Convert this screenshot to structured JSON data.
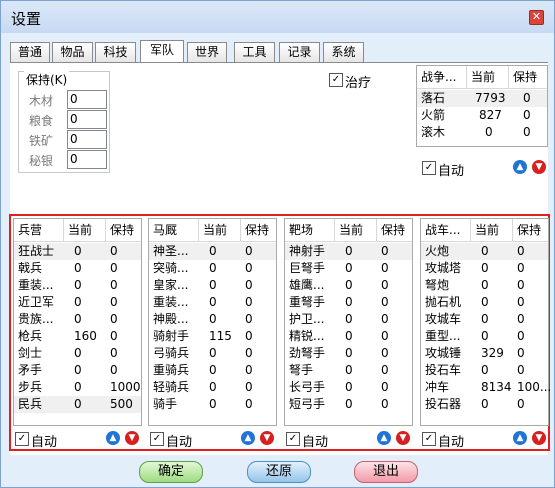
{
  "window": {
    "title": "设置",
    "close_glyph": "✕"
  },
  "tabs": [
    "普通",
    "物品",
    "科技",
    "军队",
    "世界",
    "工具",
    "记录",
    "系统"
  ],
  "active_tab": "军队",
  "keep_group": {
    "label": "保持(K)",
    "items": [
      {
        "label": "木材",
        "value": "0"
      },
      {
        "label": "粮食",
        "value": "0"
      },
      {
        "label": "铁矿",
        "value": "0"
      },
      {
        "label": "秘银",
        "value": "0"
      }
    ]
  },
  "heal": {
    "label": "治疗",
    "checked": true
  },
  "war_table": {
    "headers": [
      "战争...",
      "当前",
      "保持"
    ],
    "rows": [
      [
        "落石",
        "7793",
        "0"
      ],
      [
        "火箭",
        "827",
        "0"
      ],
      [
        "滚木",
        "0",
        "0"
      ]
    ],
    "auto_label": "自动"
  },
  "panels": [
    {
      "headers": [
        "兵营",
        "当前",
        "保持"
      ],
      "rows": [
        [
          "狂战士",
          "0",
          "0"
        ],
        [
          "戟兵",
          "0",
          "0"
        ],
        [
          "重装...",
          "0",
          "0"
        ],
        [
          "近卫军",
          "0",
          "0"
        ],
        [
          "贵族...",
          "0",
          "0"
        ],
        [
          "枪兵",
          "160",
          "0"
        ],
        [
          "剑士",
          "0",
          "0"
        ],
        [
          "矛手",
          "0",
          "0"
        ],
        [
          "步兵",
          "0",
          "1000"
        ],
        [
          "民兵",
          "0",
          "500"
        ]
      ],
      "auto_label": "自动"
    },
    {
      "headers": [
        "马厩",
        "当前",
        "保持"
      ],
      "rows": [
        [
          "神圣...",
          "0",
          "0"
        ],
        [
          "突骑...",
          "0",
          "0"
        ],
        [
          "皇家...",
          "0",
          "0"
        ],
        [
          "重装...",
          "0",
          "0"
        ],
        [
          "神殿...",
          "0",
          "0"
        ],
        [
          "骑射手",
          "115",
          "0"
        ],
        [
          "弓骑兵",
          "0",
          "0"
        ],
        [
          "重骑兵",
          "0",
          "0"
        ],
        [
          "轻骑兵",
          "0",
          "0"
        ],
        [
          "骑手",
          "0",
          "0"
        ]
      ],
      "auto_label": "自动"
    },
    {
      "headers": [
        "靶场",
        "当前",
        "保持"
      ],
      "rows": [
        [
          "神射手",
          "0",
          "0"
        ],
        [
          "巨弩手",
          "0",
          "0"
        ],
        [
          "雄鹰...",
          "0",
          "0"
        ],
        [
          "重弩手",
          "0",
          "0"
        ],
        [
          "护卫...",
          "0",
          "0"
        ],
        [
          "精锐...",
          "0",
          "0"
        ],
        [
          "劲弩手",
          "0",
          "0"
        ],
        [
          "弩手",
          "0",
          "0"
        ],
        [
          "长弓手",
          "0",
          "0"
        ],
        [
          "短弓手",
          "0",
          "0"
        ]
      ],
      "auto_label": "自动"
    },
    {
      "headers": [
        "战车...",
        "当前",
        "保持"
      ],
      "rows": [
        [
          "火炮",
          "0",
          "0"
        ],
        [
          "攻城塔",
          "0",
          "0"
        ],
        [
          "弩炮",
          "0",
          "0"
        ],
        [
          "抛石机",
          "0",
          "0"
        ],
        [
          "攻城车",
          "0",
          "0"
        ],
        [
          "重型...",
          "0",
          "0"
        ],
        [
          "攻城锤",
          "329",
          "0"
        ],
        [
          "投石车",
          "0",
          "0"
        ],
        [
          "冲车",
          "8134",
          "100..."
        ],
        [
          "投石器",
          "0",
          "0"
        ]
      ],
      "auto_label": "自动"
    }
  ],
  "buttons": {
    "ok": "确定",
    "reset": "还原",
    "exit": "退出"
  },
  "colors": {
    "highlight_border": "#e02020",
    "up_arrow": "#1f74d6",
    "down_arrow": "#d72020"
  }
}
